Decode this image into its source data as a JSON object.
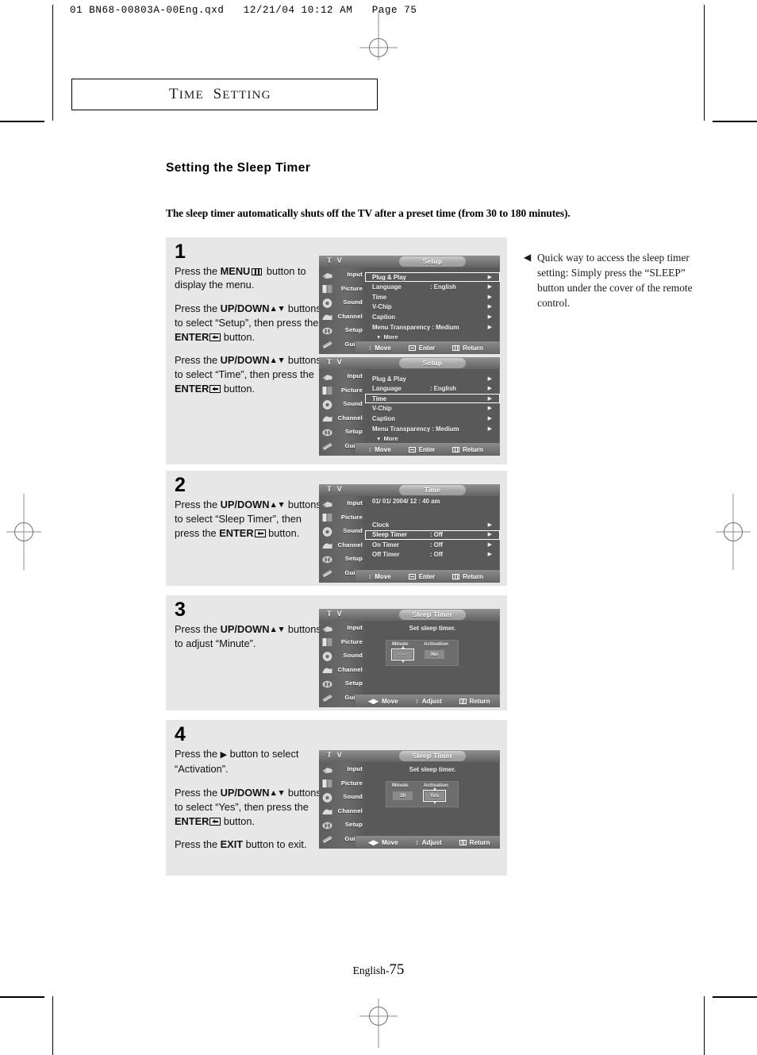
{
  "print_header": "01 BN68-00803A-00Eng.qxd   12/21/04 10:12 AM   Page 75",
  "section_title": {
    "word1": "Time",
    "word2": "Setting"
  },
  "page_heading": "Setting the Sleep Timer",
  "lead_paragraph": "The sleep timer automatically shuts off the TV after a preset time (from 30 to 180 minutes).",
  "note": {
    "bullet_icon": "left-triangle",
    "text": "Quick way to access the sleep timer setting: Simply press the “SLEEP” button under the cover of the remote control."
  },
  "footer": {
    "language": "English-",
    "page": "75"
  },
  "osd_common": {
    "brand": "T V",
    "sidebar": [
      {
        "label": "Input",
        "icon": "input-icon"
      },
      {
        "label": "Picture",
        "icon": "picture-icon"
      },
      {
        "label": "Sound",
        "icon": "sound-icon"
      },
      {
        "label": "Channel",
        "icon": "channel-icon"
      },
      {
        "label": "Setup",
        "icon": "setup-icon"
      },
      {
        "label": "Guide",
        "icon": "guide-icon"
      }
    ],
    "hint_move": "Move",
    "hint_enter": "Enter",
    "hint_return": "Return",
    "hint_adjust": "Adjust",
    "more_label": "More"
  },
  "steps": [
    {
      "number": "1",
      "paragraphs": [
        {
          "parts": [
            {
              "t": "Press the ",
              "b": false
            },
            {
              "t": "MENU",
              "b": true
            },
            {
              "t": "menu-icon",
              "icon": true
            },
            {
              "t": " button to display the menu.",
              "b": false
            }
          ]
        },
        {
          "parts": [
            {
              "t": "Press the ",
              "b": false
            },
            {
              "t": "UP/DOWN",
              "b": true
            },
            {
              "t": "updown-icon",
              "icon": true
            },
            {
              "t": " buttons to select “Setup”, then press the ",
              "b": false
            },
            {
              "t": "ENTER",
              "b": true
            },
            {
              "t": "enter-icon",
              "icon": true
            },
            {
              "t": " button.",
              "b": false
            }
          ]
        },
        {
          "parts": [
            {
              "t": "Press the ",
              "b": false
            },
            {
              "t": "UP/DOWN",
              "b": true
            },
            {
              "t": "updown-icon",
              "icon": true
            },
            {
              "t": " buttons to select “Time”, then press the ",
              "b": false
            },
            {
              "t": "ENTER",
              "b": true
            },
            {
              "t": "enter-icon",
              "icon": true
            },
            {
              "t": " button.",
              "b": false
            }
          ]
        }
      ]
    },
    {
      "number": "2",
      "paragraphs": [
        {
          "parts": [
            {
              "t": "Press the ",
              "b": false
            },
            {
              "t": "UP/DOWN",
              "b": true
            },
            {
              "t": "updown-icon",
              "icon": true
            },
            {
              "t": " buttons to select “Sleep Timer”, then press the ",
              "b": false
            },
            {
              "t": "ENTER",
              "b": true
            },
            {
              "t": "enter-icon",
              "icon": true
            },
            {
              "t": " button.",
              "b": false
            }
          ]
        }
      ]
    },
    {
      "number": "3",
      "paragraphs": [
        {
          "parts": [
            {
              "t": "Press the ",
              "b": false
            },
            {
              "t": "UP/DOWN",
              "b": true
            },
            {
              "t": "updown-icon",
              "icon": true
            },
            {
              "t": " buttons to adjust “Minute”.",
              "b": false
            }
          ]
        }
      ]
    },
    {
      "number": "4",
      "paragraphs": [
        {
          "parts": [
            {
              "t": "Press the ",
              "b": false
            },
            {
              "t": "right-arrow-icon",
              "icon": true
            },
            {
              "t": " button to select “Activation”.",
              "b": false
            }
          ]
        },
        {
          "parts": [
            {
              "t": "Press the ",
              "b": false
            },
            {
              "t": "UP/DOWN",
              "b": true
            },
            {
              "t": "updown-icon",
              "icon": true
            },
            {
              "t": " buttons to select “Yes”, then press the ",
              "b": false
            },
            {
              "t": "ENTER",
              "b": true
            },
            {
              "t": "enter-icon",
              "icon": true
            },
            {
              "t": " button.",
              "b": false
            }
          ]
        },
        {
          "parts": [
            {
              "t": "Press the ",
              "b": false
            },
            {
              "t": "EXIT",
              "b": true
            },
            {
              "t": " button to exit.",
              "b": false
            }
          ]
        }
      ]
    }
  ],
  "osd_screens": [
    {
      "id": "setup-plugplay",
      "tab": "Setup",
      "rows": [
        {
          "name": "Plug & Play",
          "value": "",
          "arrow": true,
          "selected": true
        },
        {
          "name": "Language",
          "value": ": English",
          "arrow": true,
          "selected": false
        },
        {
          "name": "Time",
          "value": "",
          "arrow": true,
          "selected": false
        },
        {
          "name": "V-Chip",
          "value": "",
          "arrow": true,
          "selected": false
        },
        {
          "name": "Caption",
          "value": "",
          "arrow": true,
          "selected": false
        },
        {
          "name": "Menu Transparency : Medium",
          "value": "",
          "arrow": true,
          "selected": false
        }
      ],
      "more": true,
      "hints": [
        "Move",
        "Enter",
        "Return"
      ]
    },
    {
      "id": "setup-time",
      "tab": "Setup",
      "rows": [
        {
          "name": "Plug & Play",
          "value": "",
          "arrow": true,
          "selected": false
        },
        {
          "name": "Language",
          "value": ": English",
          "arrow": true,
          "selected": false
        },
        {
          "name": "Time",
          "value": "",
          "arrow": true,
          "selected": true
        },
        {
          "name": "V-Chip",
          "value": "",
          "arrow": true,
          "selected": false
        },
        {
          "name": "Caption",
          "value": "",
          "arrow": true,
          "selected": false
        },
        {
          "name": "Menu Transparency : Medium",
          "value": "",
          "arrow": true,
          "selected": false
        }
      ],
      "more": true,
      "hints": [
        "Move",
        "Enter",
        "Return"
      ]
    },
    {
      "id": "time-menu",
      "tab": "Time",
      "datetime": "01/ 01/ 2004/ 12 : 40 am",
      "rows": [
        {
          "name": "Clock",
          "value": "",
          "arrow": true,
          "selected": false
        },
        {
          "name": "Sleep Timer",
          "value": ": Off",
          "arrow": true,
          "selected": true
        },
        {
          "name": "On Timer",
          "value": ": Off",
          "arrow": true,
          "selected": false
        },
        {
          "name": "Off Timer",
          "value": ": Off",
          "arrow": true,
          "selected": false
        }
      ],
      "more": false,
      "hints": [
        "Move",
        "Enter",
        "Return"
      ]
    },
    {
      "id": "sleep-timer-minute",
      "tab": "Sleep Timer",
      "message": "Set sleep timer.",
      "panel": {
        "minute_label": "Minute",
        "activation_label": "Activation",
        "minute_value": "- - -",
        "activation_value": "No",
        "selected_field": "minute"
      },
      "hints": [
        "Move",
        "Adjust",
        "Return"
      ]
    },
    {
      "id": "sleep-timer-activation",
      "tab": "Sleep Timer",
      "message": "Set sleep timer.",
      "panel": {
        "minute_label": "Minute",
        "activation_label": "Activation",
        "minute_value": "30",
        "activation_value": "Yes",
        "selected_field": "activation"
      },
      "hints": [
        "Move",
        "Adjust",
        "Return"
      ]
    }
  ]
}
